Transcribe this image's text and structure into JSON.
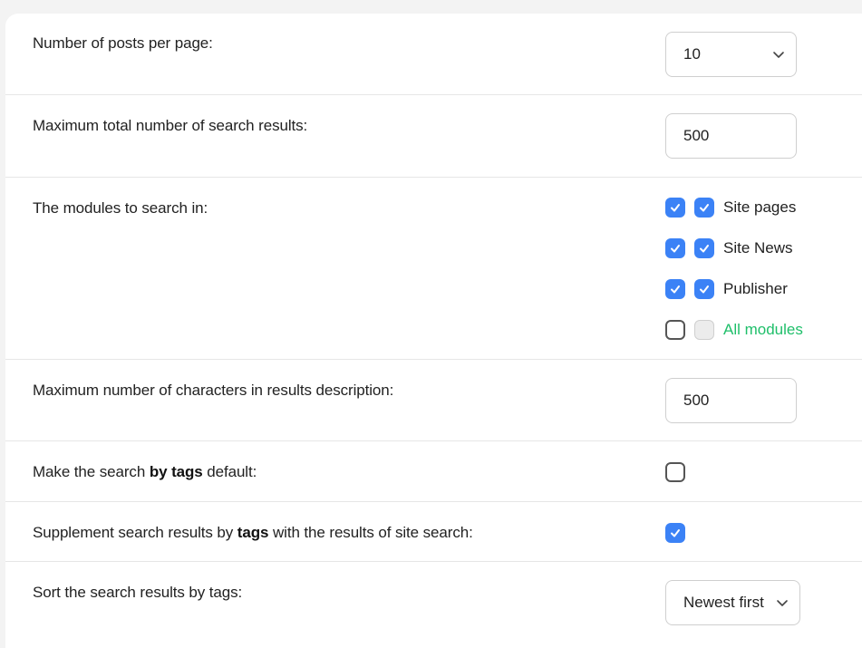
{
  "settings": {
    "posts_per_page": {
      "label": "Number of posts per page:",
      "value": "10"
    },
    "max_results": {
      "label": "Maximum total number of search results:",
      "value": "500"
    },
    "modules": {
      "label": "The modules to search in:",
      "items": [
        {
          "name": "Site pages",
          "checked": true
        },
        {
          "name": "Site News",
          "checked": true
        },
        {
          "name": "Publisher",
          "checked": true
        },
        {
          "name": "All modules",
          "checked": false
        }
      ]
    },
    "max_chars": {
      "label": "Maximum number of characters in results description:",
      "value": "500"
    },
    "tags_default": {
      "label_pre": "Make the search ",
      "label_bold": "by tags",
      "label_post": " default:",
      "checked": false
    },
    "supplement": {
      "label_pre": "Supplement search results by ",
      "label_bold": "tags",
      "label_post": " with the results of site search:",
      "checked": true
    },
    "sort": {
      "label": "Sort the search results by tags:",
      "value": "Newest first"
    }
  },
  "colors": {
    "accent": "#3b82f6",
    "green_link": "#1fbf6a"
  },
  "icons": {
    "checkmark": "check-icon",
    "dropdown": "chevron-down-icon"
  }
}
